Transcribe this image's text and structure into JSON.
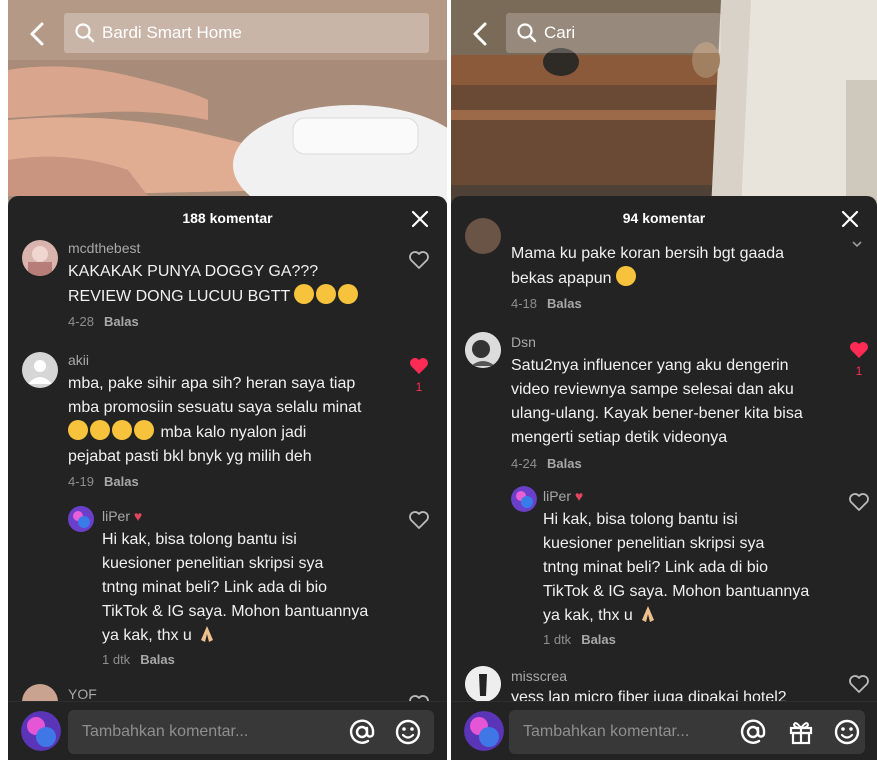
{
  "left": {
    "search_text": "Bardi Smart Home",
    "comment_count": "188 komentar",
    "input_placeholder": "Tambahkan komentar...",
    "comments": [
      {
        "user": "mcdthebest",
        "lines": [
          "KAKAKAK PUNYA DOGGY GA???",
          "REVIEW DONG LUCUU BGTT"
        ],
        "time": "4-28",
        "reply": "Balas"
      },
      {
        "user": "akii",
        "lines": [
          "mba, pake sihir apa sih? heran saya tiap",
          "mba promosiin sesuatu saya selalu minat",
          "mba kalo nyalon jadi",
          "pejabat pasti bkl bnyk yg milih deh"
        ],
        "time": "4-19",
        "reply": "Balas",
        "likes": "1"
      },
      {
        "user": "liPer",
        "lines": [
          "Hi kak, bisa tolong bantu isi",
          "kuesioner penelitian skripsi sya",
          "tntng minat beli? Link ada di bio",
          "TikTok & IG saya. Mohon bantuannya",
          "ya kak, thx u"
        ],
        "time": "1 dtk",
        "reply": "Balas"
      },
      {
        "user": "YOF"
      }
    ]
  },
  "right": {
    "search_text": "Cari",
    "comment_count": "94 komentar",
    "input_placeholder": "Tambahkan komentar...",
    "comments": [
      {
        "lines": [
          "Mama ku pake koran bersih bgt gaada",
          "bekas apapun"
        ],
        "time": "4-18",
        "reply": "Balas"
      },
      {
        "user": "Dsn",
        "lines": [
          "Satu2nya influencer yang aku dengerin",
          "video reviewnya sampe selesai dan aku",
          "ulang-ulang. Kayak bener-bener kita bisa",
          "mengerti setiap detik videonya"
        ],
        "time": "4-24",
        "reply": "Balas",
        "likes": "1"
      },
      {
        "user": "liPer",
        "lines": [
          "Hi kak, bisa tolong bantu isi",
          "kuesioner penelitian skripsi sya",
          "tntng minat beli? Link ada di bio",
          "TikTok & IG saya. Mohon bantuannya",
          "ya kak, thx u"
        ],
        "time": "1 dtk",
        "reply": "Balas"
      },
      {
        "user": "misscrea",
        "lines": [
          "yess lap micro fiber juga dipakai hotel2"
        ]
      }
    ]
  },
  "colors": {
    "like_red": "#fe2c55",
    "sheet_bg": "#232323"
  }
}
